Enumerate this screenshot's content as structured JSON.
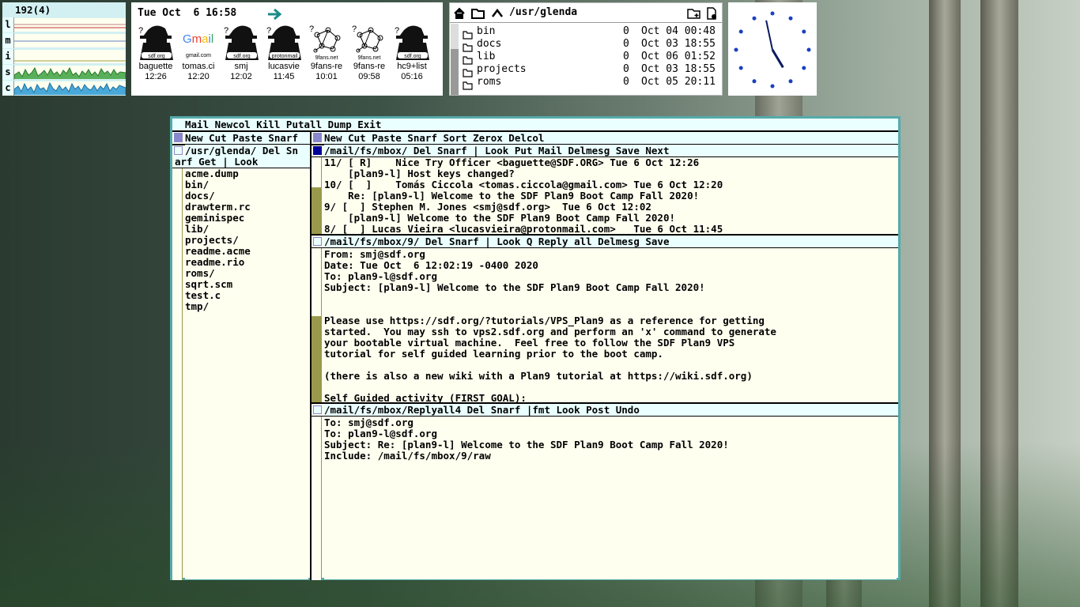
{
  "stats": {
    "header": "192(4)",
    "rows": [
      {
        "label": "l"
      },
      {
        "label": "m"
      },
      {
        "label": "i"
      },
      {
        "label": "s"
      },
      {
        "label": "c"
      }
    ]
  },
  "faces": {
    "datetime": "Tue Oct  6 16:58",
    "items": [
      {
        "name": "baguette",
        "time": "12:26",
        "badge": "sdf.org",
        "icon": "spy-face-icon"
      },
      {
        "name": "tomas.ci",
        "time": "12:20",
        "badge": "gmail.com",
        "icon": "gmail-logo-icon"
      },
      {
        "name": "smj",
        "time": "12:02",
        "badge": "sdf.org",
        "icon": "spy-face-icon"
      },
      {
        "name": "lucasvie",
        "time": "11:45",
        "badge": "protonmail",
        "icon": "spy-face-icon"
      },
      {
        "name": "9fans-re",
        "time": "10:01",
        "badge": "9fans.net",
        "icon": "network-graph-icon"
      },
      {
        "name": "9fans-re",
        "time": "09:58",
        "badge": "9fans.net",
        "icon": "network-graph-icon"
      },
      {
        "name": "hc9+list",
        "time": "05:16",
        "badge": "sdf.org",
        "icon": "spy-face-icon"
      }
    ]
  },
  "files": {
    "path": "/usr/glenda",
    "rows": [
      {
        "name": "bin",
        "size": "0",
        "date": "Oct 04 00:48"
      },
      {
        "name": "docs",
        "size": "0",
        "date": "Oct 03 18:55"
      },
      {
        "name": "lib",
        "size": "0",
        "date": "Oct 06 01:52"
      },
      {
        "name": "projects",
        "size": "0",
        "date": "Oct 03 18:55"
      },
      {
        "name": "roms",
        "size": "0",
        "date": "Oct 05 20:11"
      }
    ]
  },
  "acme": {
    "main_tag": "Mail Newcol Kill Putall Dump Exit",
    "col1_tag": "New Cut Paste Snarf",
    "col2_tag": "New Cut Paste Snarf Sort Zerox Delcol",
    "dir_tag_1": "/usr/glenda/ Del Sn",
    "dir_tag_2": "arf Get | Look",
    "dir_entries": [
      "acme.dump",
      "bin/",
      "docs/",
      "drawterm.rc",
      "geminispec",
      "lib/",
      "projects/",
      "readme.acme",
      "readme.rio",
      "roms/",
      "sqrt.scm",
      "test.c",
      "tmp/"
    ],
    "mbox_tag": "/mail/fs/mbox/ Del Snarf | Look Put Mail Delmesg Save Next",
    "mbox_lines": [
      "11/ [ R]    Nice Try Officer <baguette@SDF.ORG> Tue 6 Oct 12:26",
      "    [plan9-l] Host keys changed?",
      "10/ [  ]    Tomás Ciccola <tomas.ciccola@gmail.com> Tue 6 Oct 12:20",
      "    Re: [plan9-l] Welcome to the SDF Plan9 Boot Camp Fall 2020!",
      "9/ [  ] Stephen M. Jones <smj@sdf.org>  Tue 6 Oct 12:02",
      "    [plan9-l] Welcome to the SDF Plan9 Boot Camp Fall 2020!",
      "8/ [  ] Lucas Vieira <lucasvieira@protonmail.com>   Tue 6 Oct 11:45"
    ],
    "msg_tag": "/mail/fs/mbox/9/ Del Snarf | Look Q Reply all Delmesg Save",
    "msg_lines": [
      "From: smj@sdf.org",
      "Date: Tue Oct  6 12:02:19 -0400 2020",
      "To: plan9-l@sdf.org",
      "Subject: [plan9-l] Welcome to the SDF Plan9 Boot Camp Fall 2020!",
      "",
      "",
      "Please use https://sdf.org/?tutorials/VPS_Plan9 as a reference for getting",
      "started.  You may ssh to vps2.sdf.org and perform an 'x' command to generate",
      "your bootable virtual machine.  Feel free to follow the SDF Plan9 VPS",
      "tutorial for self guided learning prior to the boot camp.",
      "",
      "(there is also a new wiki with a Plan9 tutorial at https://wiki.sdf.org)",
      "",
      "Self Guided activity (FIRST GOAL):"
    ],
    "reply_tag": "/mail/fs/mbox/Replyall4 Del Snarf |fmt Look Post Undo",
    "reply_lines": [
      "To: smj@sdf.org",
      "To: plan9-l@sdf.org",
      "Subject: Re: [plan9-l] Welcome to the SDF Plan9 Boot Camp Fall 2020!",
      "Include: /mail/fs/mbox/9/raw"
    ]
  },
  "colors": {
    "tag_bg": "#eaffff",
    "body_bg": "#fffff0",
    "scroll": "#99994c",
    "border": "#55aaaa",
    "accent": "#1b8a8a"
  }
}
